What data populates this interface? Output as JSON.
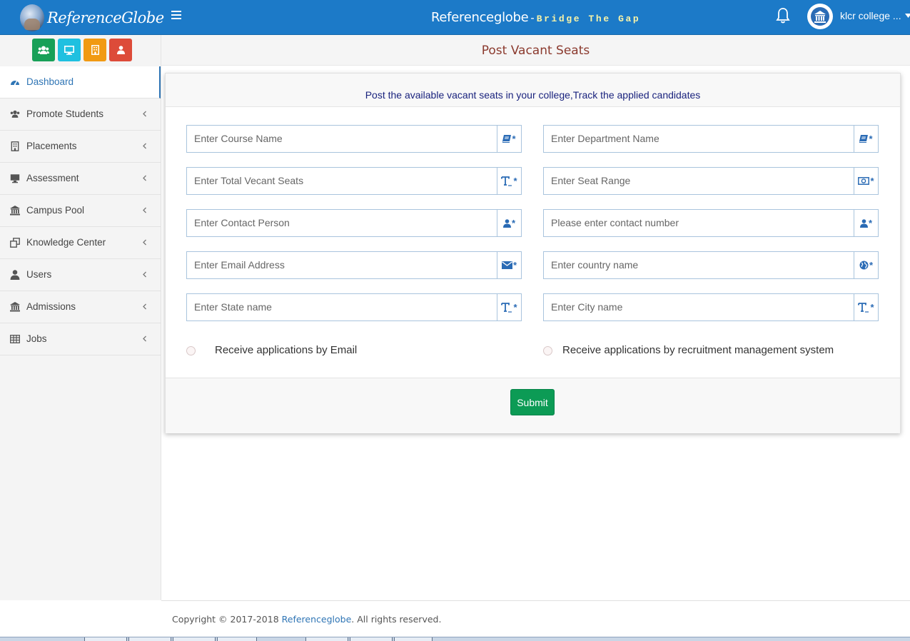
{
  "header": {
    "logo_text": "ReferenceGlobe",
    "title": "Referenceglobe",
    "title_separator": "-",
    "tagline": "Bridge The Gap",
    "user_name": "klcr college ..."
  },
  "sidebar": {
    "quick_buttons": [
      {
        "icon": "users-icon",
        "color": "#18a058"
      },
      {
        "icon": "desktop-icon",
        "color": "#1fc0e0"
      },
      {
        "icon": "building-icon",
        "color": "#f19a12"
      },
      {
        "icon": "user-icon",
        "color": "#dd4b39"
      }
    ],
    "items": [
      {
        "label": "Dashboard",
        "icon": "dashboard-icon",
        "active": true
      },
      {
        "label": "Promote Students",
        "icon": "users-icon"
      },
      {
        "label": "Placements",
        "icon": "building-icon"
      },
      {
        "label": "Assessment",
        "icon": "desktop-icon"
      },
      {
        "label": "Campus Pool",
        "icon": "institution-icon"
      },
      {
        "label": "Knowledge Center",
        "icon": "clone-icon"
      },
      {
        "label": "Users",
        "icon": "user-icon"
      },
      {
        "label": "Admissions",
        "icon": "institution-icon"
      },
      {
        "label": "Jobs",
        "icon": "table-icon"
      }
    ]
  },
  "page": {
    "title": "Post Vacant Seats",
    "subtitle": "Post the available vacant seats in your college,Track the applied candidates"
  },
  "form": {
    "course_placeholder": "Enter Course Name",
    "department_placeholder": "Enter Department Name",
    "total_seats_placeholder": "Enter Total Vecant Seats",
    "seat_range_placeholder": "Enter Seat Range",
    "contact_person_placeholder": "Enter Contact Person",
    "contact_number_placeholder": "Please enter contact number",
    "email_placeholder": "Enter Email Address",
    "country_placeholder": "Enter country name",
    "state_placeholder": "Enter State name",
    "city_placeholder": "Enter City name",
    "required_marker": "*",
    "radio_email_label": "Receive applications by Email",
    "radio_rms_label": "Receive applications by recruitment management system",
    "submit_label": "Submit"
  },
  "footer": {
    "copyright_prefix": "Copyright © 2017-2018 ",
    "brand_link": "Referenceglobe",
    "copyright_suffix": ". All rights reserved."
  }
}
